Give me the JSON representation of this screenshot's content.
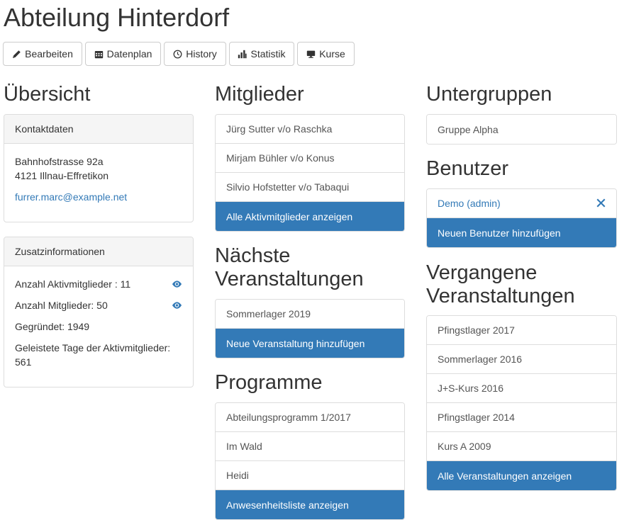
{
  "page": {
    "title": "Abteilung Hinterdorf"
  },
  "toolbar": {
    "edit_label": "Bearbeiten",
    "datenplan_label": "Datenplan",
    "history_label": "History",
    "statistik_label": "Statistik",
    "kurse_label": "Kurse"
  },
  "overview": {
    "title": "Übersicht",
    "contact": {
      "header": "Kontaktdaten",
      "street": "Bahnhofstrasse 92a",
      "city": "4121 Illnau-Effretikon",
      "email": "furrer.marc@example.net"
    },
    "extra": {
      "header": "Zusatzinformationen",
      "active_members": "Anzahl Aktivmitglieder : 11",
      "members": "Anzahl Mitglieder: 50",
      "founded": "Gegründet: 1949",
      "days_label": "Geleistete Tage der Aktivmitglieder:",
      "days_value": "561"
    }
  },
  "members": {
    "title": "Mitglieder",
    "items": [
      "Jürg Sutter v/o Raschka",
      "Mirjam Bühler v/o Konus",
      "Silvio Hofstetter v/o Tabaqui"
    ],
    "action": "Alle Aktivmitglieder anzeigen"
  },
  "next_events": {
    "title_line1": "Nächste",
    "title_line2": "Veranstaltungen",
    "items": [
      "Sommerlager 2019"
    ],
    "action": "Neue Veranstaltung hinzufügen"
  },
  "programs": {
    "title": "Programme",
    "items": [
      "Abteilungsprogramm 1/2017",
      "Im Wald",
      "Heidi"
    ],
    "action": "Anwesenheitsliste anzeigen"
  },
  "subgroups": {
    "title": "Untergruppen",
    "items": [
      "Gruppe Alpha"
    ]
  },
  "users": {
    "title": "Benutzer",
    "items": [
      "Demo (admin)"
    ],
    "action": "Neuen Benutzer hinzufügen"
  },
  "past_events": {
    "title_line1": "Vergangene",
    "title_line2": "Veranstaltungen",
    "items": [
      "Pfingstlager 2017",
      "Sommerlager 2016",
      "J+S-Kurs 2016",
      "Pfingstlager 2014",
      "Kurs A 2009"
    ],
    "action": "Alle Veranstaltungen anzeigen"
  },
  "colors": {
    "primary": "#337ab7",
    "border": "#dddddd",
    "panel_heading": "#f5f5f5"
  },
  "icons": [
    "pencil-icon",
    "calendar-icon",
    "clock-icon",
    "bar-chart-icon",
    "monitor-icon",
    "eye-icon",
    "close-icon"
  ]
}
